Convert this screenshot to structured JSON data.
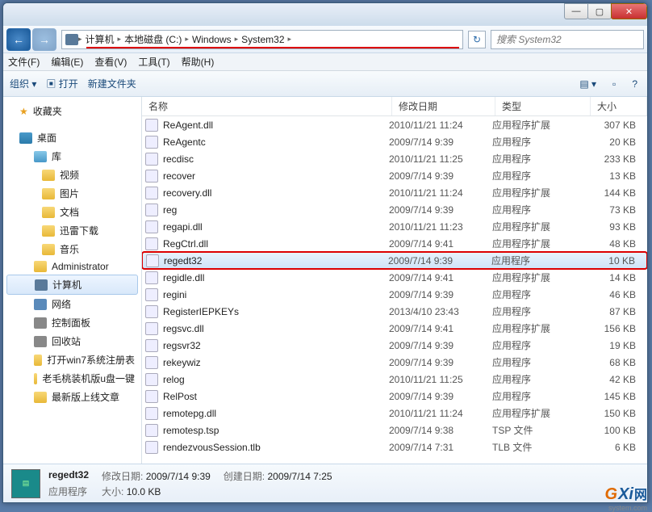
{
  "titlebar": {
    "min": "—",
    "max": "▢",
    "close": "✕"
  },
  "nav": {
    "back": "←",
    "fwd": "→",
    "refresh": "↻"
  },
  "breadcrumbs": [
    "计算机",
    "本地磁盘 (C:)",
    "Windows",
    "System32"
  ],
  "search": {
    "placeholder": "搜索 System32"
  },
  "menu": [
    "文件(F)",
    "编辑(E)",
    "查看(V)",
    "工具(T)",
    "帮助(H)"
  ],
  "toolbar": {
    "organize": "组织 ▾",
    "open": "打开",
    "newfolder": "新建文件夹",
    "view": "▤ ▾",
    "help": "?"
  },
  "sidebar": {
    "favorites": "收藏夹",
    "desktop": "桌面",
    "library": "库",
    "video": "视频",
    "pictures": "图片",
    "documents": "文档",
    "thunder": "迅雷下载",
    "music": "音乐",
    "admin": "Administrator",
    "computer": "计算机",
    "network": "网络",
    "control": "控制面板",
    "recycle": "回收站",
    "folder1": "打开win7系统注册表",
    "folder2": "老毛桃装机版u盘一键",
    "folder3": "最新版上线文章"
  },
  "columns": {
    "name": "名称",
    "date": "修改日期",
    "type": "类型",
    "size": "大小"
  },
  "types": {
    "ext": "应用程序扩展",
    "app": "应用程序",
    "tsp": "TSP 文件",
    "tlb": "TLB 文件"
  },
  "files": [
    {
      "n": "ReAgent.dll",
      "d": "2010/11/21 11:24",
      "t": "ext",
      "s": "307 KB"
    },
    {
      "n": "ReAgentc",
      "d": "2009/7/14 9:39",
      "t": "app",
      "s": "20 KB"
    },
    {
      "n": "recdisc",
      "d": "2010/11/21 11:25",
      "t": "app",
      "s": "233 KB"
    },
    {
      "n": "recover",
      "d": "2009/7/14 9:39",
      "t": "app",
      "s": "13 KB"
    },
    {
      "n": "recovery.dll",
      "d": "2010/11/21 11:24",
      "t": "ext",
      "s": "144 KB"
    },
    {
      "n": "reg",
      "d": "2009/7/14 9:39",
      "t": "app",
      "s": "73 KB"
    },
    {
      "n": "regapi.dll",
      "d": "2010/11/21 11:23",
      "t": "ext",
      "s": "93 KB"
    },
    {
      "n": "RegCtrl.dll",
      "d": "2009/7/14 9:41",
      "t": "ext",
      "s": "48 KB"
    },
    {
      "n": "regedt32",
      "d": "2009/7/14 9:39",
      "t": "app",
      "s": "10 KB",
      "sel": true,
      "hl": true
    },
    {
      "n": "regidle.dll",
      "d": "2009/7/14 9:41",
      "t": "ext",
      "s": "14 KB"
    },
    {
      "n": "regini",
      "d": "2009/7/14 9:39",
      "t": "app",
      "s": "46 KB"
    },
    {
      "n": "RegisterIEPKEYs",
      "d": "2013/4/10 23:43",
      "t": "app",
      "s": "87 KB"
    },
    {
      "n": "regsvc.dll",
      "d": "2009/7/14 9:41",
      "t": "ext",
      "s": "156 KB"
    },
    {
      "n": "regsvr32",
      "d": "2009/7/14 9:39",
      "t": "app",
      "s": "19 KB"
    },
    {
      "n": "rekeywiz",
      "d": "2009/7/14 9:39",
      "t": "app",
      "s": "68 KB"
    },
    {
      "n": "relog",
      "d": "2010/11/21 11:25",
      "t": "app",
      "s": "42 KB"
    },
    {
      "n": "RelPost",
      "d": "2009/7/14 9:39",
      "t": "app",
      "s": "145 KB"
    },
    {
      "n": "remotepg.dll",
      "d": "2010/11/21 11:24",
      "t": "ext",
      "s": "150 KB"
    },
    {
      "n": "remotesp.tsp",
      "d": "2009/7/14 9:38",
      "t": "tsp",
      "s": "100 KB"
    },
    {
      "n": "rendezvousSession.tlb",
      "d": "2009/7/14 7:31",
      "t": "tlb",
      "s": "6 KB"
    }
  ],
  "details": {
    "name": "regedt32",
    "type": "应用程序",
    "modLabel": "修改日期:",
    "mod": "2009/7/14 9:39",
    "sizeLabel": "大小:",
    "size": "10.0 KB",
    "createdLabel": "创建日期:",
    "created": "2009/7/14 7:25"
  },
  "watermark": {
    "g": "G",
    "xi": "Xi",
    "wang": "网",
    "url": "system.com"
  }
}
